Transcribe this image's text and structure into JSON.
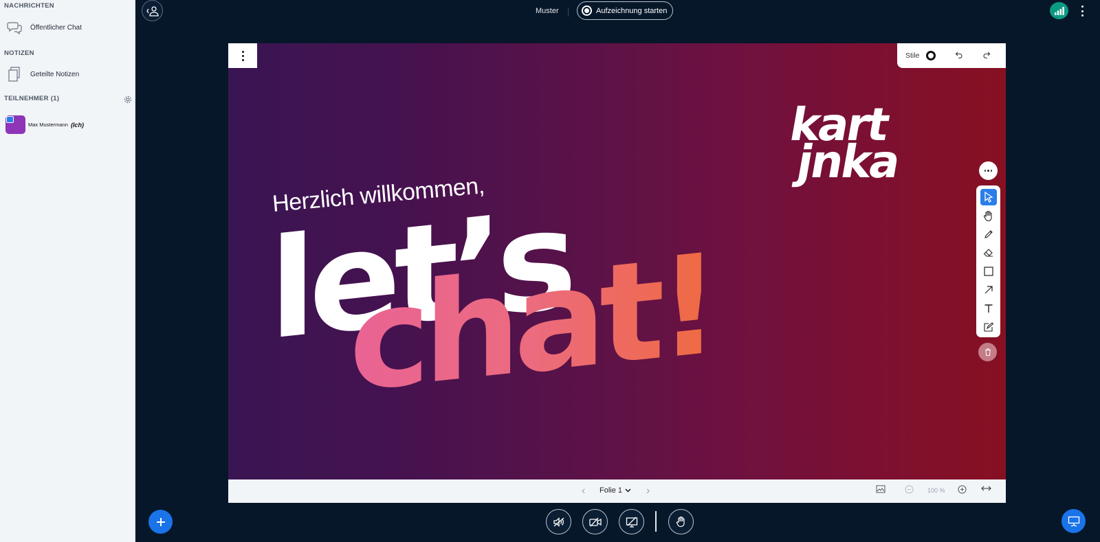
{
  "sidebar": {
    "messages_heading": "NACHRICHTEN",
    "public_chat_label": "Öffentlicher Chat",
    "notes_heading": "NOTIZEN",
    "shared_notes_label": "Geteilte Notizen",
    "participants_heading": "TEILNEHMER (1)",
    "participant": {
      "name": "Max Mustermann",
      "me_tag": "(Ich)"
    }
  },
  "topbar": {
    "meeting_name": "Muster",
    "record_label": "Aufzeichnung starten"
  },
  "presentation": {
    "styles_label": "Stile",
    "slide_selector": "Folie 1",
    "zoom": "100 %",
    "slide": {
      "greeting": "Herzlich willkommen,",
      "headline_1": "let’s",
      "headline_2": "chat!",
      "logo_line_1": "kart",
      "logo_line_2": "jnka"
    }
  },
  "colors": {
    "accent": "#1a73e8",
    "connection": "#0c9a82",
    "background": "#06172a"
  }
}
